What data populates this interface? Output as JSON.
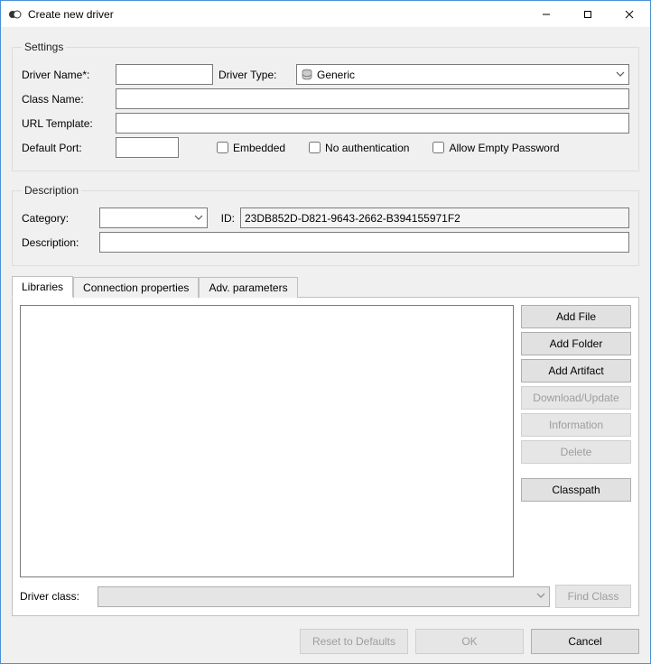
{
  "window": {
    "title": "Create new driver"
  },
  "settings": {
    "legend": "Settings",
    "driver_name_label": "Driver Name*:",
    "driver_name_value": "",
    "driver_type_label": "Driver Type:",
    "driver_type_value": "Generic",
    "class_name_label": "Class Name:",
    "class_name_value": "",
    "url_template_label": "URL Template:",
    "url_template_value": "",
    "default_port_label": "Default Port:",
    "default_port_value": "",
    "embedded_label": "Embedded",
    "noauth_label": "No authentication",
    "allow_empty_pw_label": "Allow Empty Password"
  },
  "description": {
    "legend": "Description",
    "category_label": "Category:",
    "category_value": "",
    "id_label": "ID:",
    "id_value": "23DB852D-D821-9643-2662-B394155971F2",
    "description_label": "Description:",
    "description_value": ""
  },
  "tabs": {
    "libraries": "Libraries",
    "connection_properties": "Connection properties",
    "adv_parameters": "Adv. parameters"
  },
  "lib_buttons": {
    "add_file": "Add File",
    "add_folder": "Add Folder",
    "add_artifact": "Add Artifact",
    "download_update": "Download/Update",
    "information": "Information",
    "delete": "Delete",
    "classpath": "Classpath"
  },
  "driver_class": {
    "label": "Driver class:",
    "value": "",
    "find_class": "Find Class"
  },
  "footer": {
    "reset": "Reset to Defaults",
    "ok": "OK",
    "cancel": "Cancel"
  }
}
